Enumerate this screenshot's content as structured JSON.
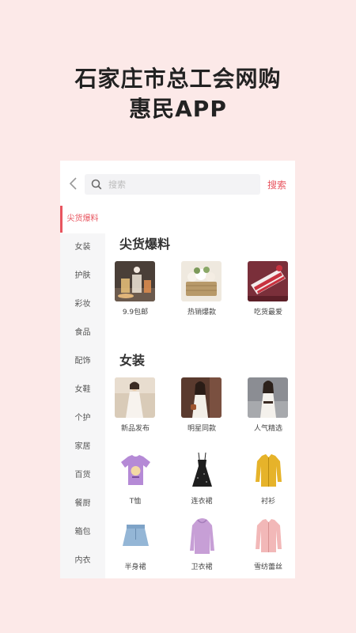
{
  "promo": {
    "line1": "石家庄市总工会网购",
    "line2": "惠民APP"
  },
  "search": {
    "placeholder": "搜索",
    "button_label": "搜索"
  },
  "sidebar": {
    "items": [
      {
        "label": "尖货爆料",
        "active": true
      },
      {
        "label": "女装"
      },
      {
        "label": "护肤"
      },
      {
        "label": "彩妆"
      },
      {
        "label": "食品"
      },
      {
        "label": "配饰"
      },
      {
        "label": "女鞋"
      },
      {
        "label": "个护"
      },
      {
        "label": "家居"
      },
      {
        "label": "百货"
      },
      {
        "label": "餐厨"
      },
      {
        "label": "箱包"
      },
      {
        "label": "内衣"
      }
    ]
  },
  "sections": [
    {
      "title": "尖货爆料",
      "items": [
        {
          "label": "9.9包邮",
          "icon": "drinks-photo"
        },
        {
          "label": "热销爆款",
          "icon": "flower-basket-photo"
        },
        {
          "label": "吃货最爱",
          "icon": "cake-photo"
        }
      ]
    },
    {
      "title": "女装",
      "items": [
        {
          "label": "新品发布",
          "icon": "model-photo"
        },
        {
          "label": "明星同款",
          "icon": "model-photo"
        },
        {
          "label": "人气精选",
          "icon": "model-photo"
        },
        {
          "label": "T恤",
          "icon": "tshirt-icon"
        },
        {
          "label": "连衣裙",
          "icon": "black-dress-icon"
        },
        {
          "label": "衬衫",
          "icon": "shirt-icon"
        },
        {
          "label": "半身裙",
          "icon": "skirt-icon"
        },
        {
          "label": "卫衣裙",
          "icon": "hoodie-icon"
        },
        {
          "label": "雪纺蕾丝",
          "icon": "blouse-icon"
        }
      ]
    }
  ],
  "colors": {
    "accent": "#e8555f",
    "page_background": "#fce9e8",
    "sidebar_background": "#f6f6f7"
  }
}
